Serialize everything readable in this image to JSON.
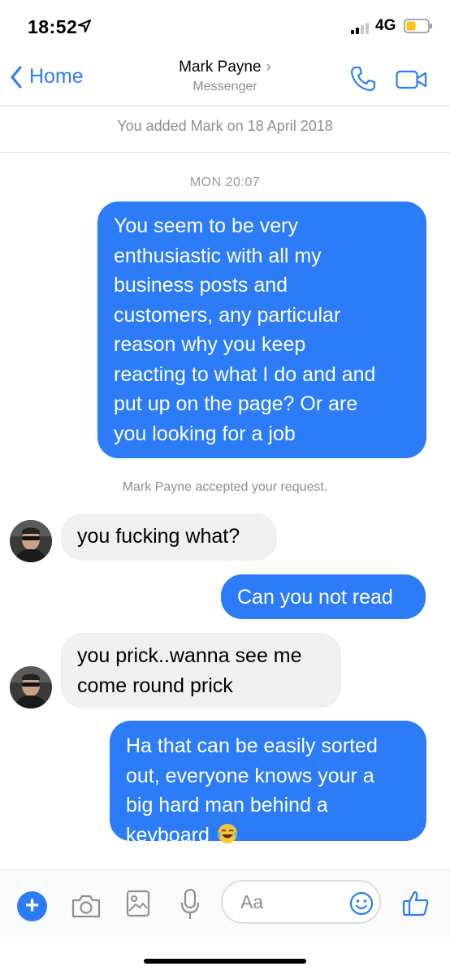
{
  "status_bar": {
    "time": "18:52",
    "network": "4G"
  },
  "header": {
    "back_label": "Home",
    "contact_name": "Mark Payne",
    "subtitle": "Messenger"
  },
  "thread": {
    "added_notice": "You added Mark on 18 April 2018",
    "timestamp": "MON 20:07",
    "accepted_notice": "Mark Payne accepted your request.",
    "messages": [
      {
        "direction": "outgoing",
        "lines": [
          "You seem to be very",
          "enthusiastic with all my",
          "business posts and",
          "customers, any particular",
          "reason why you keep",
          "reacting to what I do and and",
          "put up on the page? Or are",
          "you looking for a job"
        ]
      },
      {
        "direction": "incoming",
        "lines": [
          "you fucking what?"
        ]
      },
      {
        "direction": "outgoing",
        "lines": [
          "Can you not read"
        ]
      },
      {
        "direction": "incoming",
        "lines": [
          "you prick..wanna see me",
          "come round prick"
        ]
      },
      {
        "direction": "outgoing",
        "lines": [
          "Ha that can be easily sorted",
          "out, everyone knows your a",
          "big hard man behind a",
          "keyboard"
        ],
        "emoji": "face-with-tears-of-joy"
      }
    ]
  },
  "composer": {
    "placeholder": "Aa"
  },
  "colors": {
    "accent": "#2b7cf6",
    "incoming_bubble": "#f0f0f0"
  },
  "icons": [
    "location-arrow-icon",
    "signal-icon",
    "battery-icon",
    "chevron-left-icon",
    "chevron-right-icon",
    "phone-icon",
    "video-icon",
    "plus-icon",
    "camera-icon",
    "image-icon",
    "microphone-icon",
    "smiley-icon",
    "thumbs-up-icon"
  ]
}
